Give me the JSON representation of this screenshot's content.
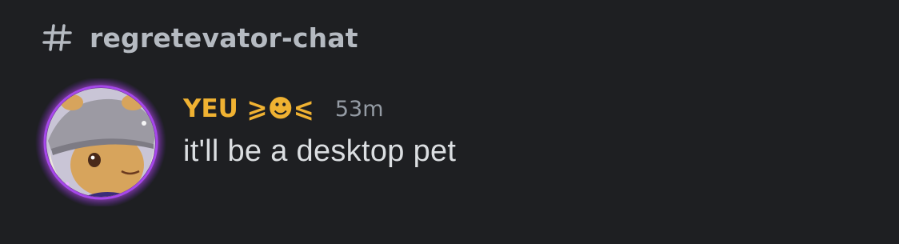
{
  "channel": {
    "icon": "hash-icon",
    "name": "regretevator-chat"
  },
  "message": {
    "avatar_icon": "user-avatar",
    "username": "YEU ⩾☻⩽",
    "username_color": "#f0b232",
    "timestamp": "53m",
    "text": "it'll be a desktop pet"
  },
  "colors": {
    "background": "#1e1f22",
    "channel_text": "#b5bac1",
    "timestamp": "#949ba4",
    "message_text": "#dbdee1"
  }
}
